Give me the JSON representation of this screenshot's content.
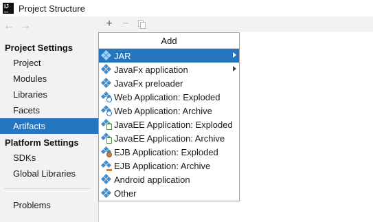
{
  "window": {
    "title": "Project Structure",
    "logo_text": "IJ"
  },
  "nav": {
    "back_glyph": "←",
    "forward_glyph": "→"
  },
  "sidebar": {
    "project_settings_header": "Project Settings",
    "project_items": [
      {
        "label": "Project"
      },
      {
        "label": "Modules"
      },
      {
        "label": "Libraries"
      },
      {
        "label": "Facets"
      },
      {
        "label": "Artifacts",
        "selected": true
      }
    ],
    "platform_settings_header": "Platform Settings",
    "platform_items": [
      {
        "label": "SDKs"
      },
      {
        "label": "Global Libraries"
      }
    ],
    "problems_label": "Problems"
  },
  "toolbar": {
    "add_glyph": "+",
    "remove_glyph": "−"
  },
  "popup": {
    "title": "Add",
    "items": [
      {
        "label": "JAR",
        "icon": "jar-icon",
        "submenu": true,
        "selected": true
      },
      {
        "label": "JavaFx application",
        "icon": "javafx-app-icon",
        "submenu": true
      },
      {
        "label": "JavaFx preloader",
        "icon": "javafx-preloader-icon"
      },
      {
        "label": "Web Application: Exploded",
        "icon": "web-app-exploded-icon"
      },
      {
        "label": "Web Application: Archive",
        "icon": "web-app-archive-icon"
      },
      {
        "label": "JavaEE Application: Exploded",
        "icon": "javaee-exploded-icon"
      },
      {
        "label": "JavaEE Application: Archive",
        "icon": "javaee-archive-icon"
      },
      {
        "label": "EJB Application: Exploded",
        "icon": "ejb-exploded-icon"
      },
      {
        "label": "EJB Application: Archive",
        "icon": "ejb-archive-icon"
      },
      {
        "label": "Android application",
        "icon": "android-app-icon"
      },
      {
        "label": "Other",
        "icon": "other-artifact-icon"
      }
    ]
  },
  "colors": {
    "selection": "#2675bf",
    "sidebar_bg": "#f2f2f2",
    "artifact_icon": "#3d8fd1"
  }
}
